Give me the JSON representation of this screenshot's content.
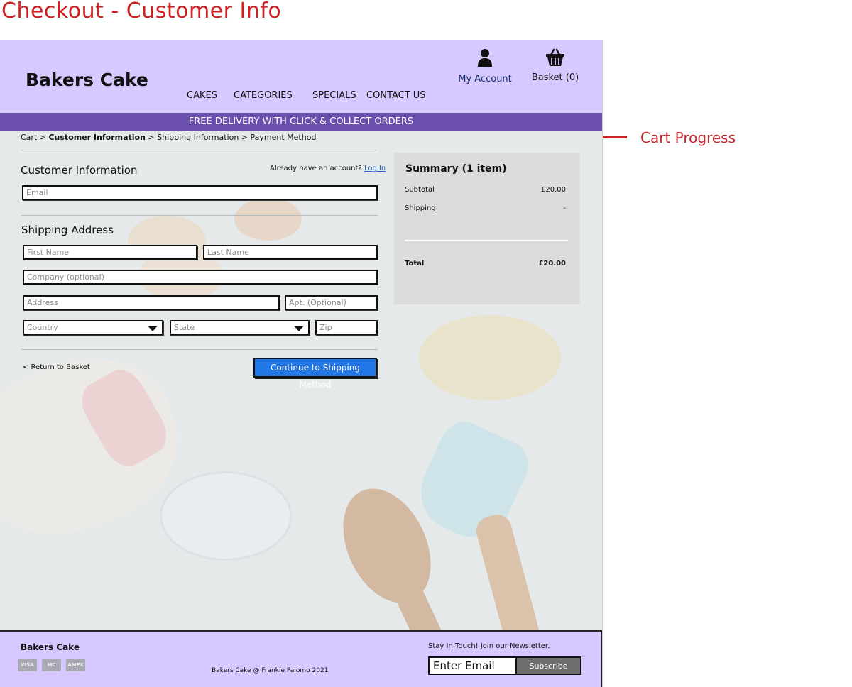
{
  "annotations": {
    "page_title": "Checkout - Customer Info",
    "cart_progress_label": "Cart Progress"
  },
  "header": {
    "logo": "Bakers Cake",
    "nav": [
      "CAKES",
      "CATEGORIES",
      "SPECIALS",
      "CONTACT US"
    ],
    "account_label": "My Account",
    "basket_label": "Basket (0)"
  },
  "banner": {
    "text": "FREE DELIVERY WITH CLICK & COLLECT ORDERS"
  },
  "breadcrumb": {
    "cart": "Cart",
    "sep": ">",
    "customer_info": "Customer Information",
    "shipping_info": "Shipping Information",
    "payment": "Payment Method"
  },
  "customer_info": {
    "title": "Customer Information",
    "login_prompt": "Already have an account?",
    "login_link": "Log In",
    "email_placeholder": "Email"
  },
  "shipping": {
    "title": "Shipping Address",
    "first_name": "First Name",
    "last_name": "Last Name",
    "company": "Company (optional)",
    "address": "Address",
    "apt": "Apt. (Optional)",
    "country": "Country",
    "state": "State",
    "zip": "Zip"
  },
  "actions": {
    "return": "< Return to Basket",
    "continue": "Continue to Shipping Method"
  },
  "summary": {
    "title": "Summary (1 item)",
    "subtotal_label": "Subtotal",
    "subtotal_value": "£20.00",
    "shipping_label": "Shipping",
    "shipping_value": "-",
    "total_label": "Total",
    "total_value": "£20.00"
  },
  "footer": {
    "logo": "Bakers Cake",
    "cards": [
      "VISA",
      "MC",
      "AMEX"
    ],
    "copyright": "Bakers Cake @ Frankie Palomo 2021",
    "newsletter_label": "Stay In Touch! Join our Newsletter.",
    "email_placeholder": "Enter Email",
    "subscribe": "Subscribe"
  },
  "colors": {
    "header_bg": "#d7c8ff",
    "banner_bg": "#6a4fae",
    "cta_bg": "#2177e5",
    "annotation_red": "#c9252c"
  }
}
